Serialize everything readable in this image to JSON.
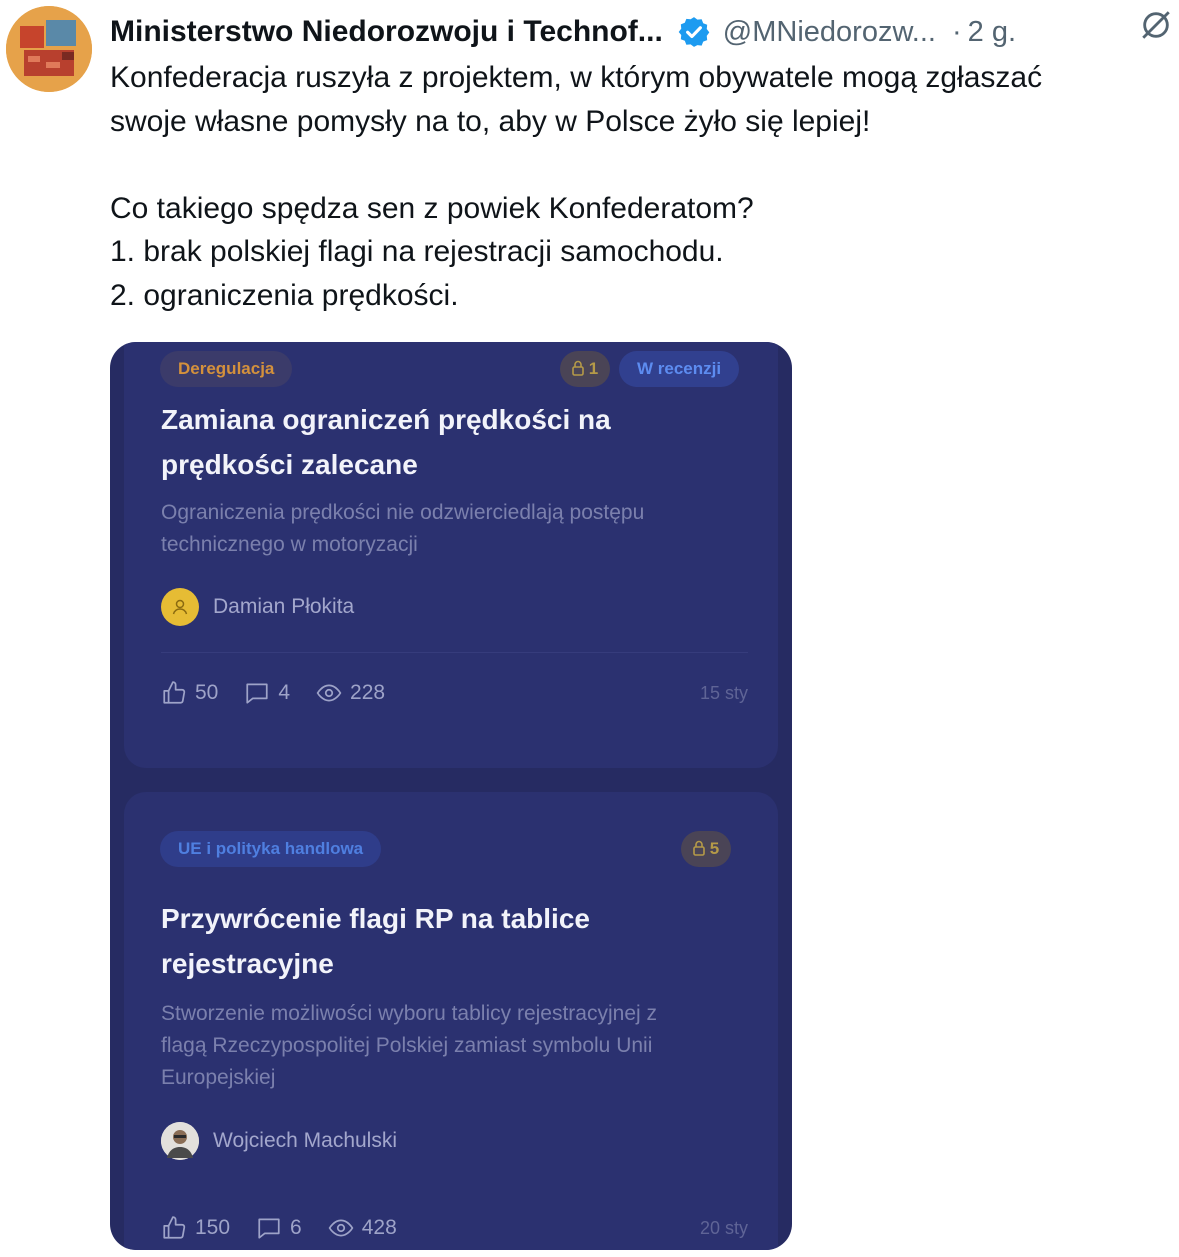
{
  "tweet": {
    "author_name": "Ministerstwo Niedorozwoju i Technof...",
    "handle": "@MNiedorozw...",
    "separator": "·",
    "time": "2 g.",
    "lines": [
      "Konfederacja ruszyła z projektem, w którym obywatele mogą zgłaszać",
      "swoje własne pomysły na to, aby w Polsce żyło się lepiej!",
      "",
      "Co takiego spędza sen z powiek Konfederatom?",
      "1. brak polskiej flagi na rejestracji samochodu.",
      "2. ograniczenia prędkości."
    ],
    "verified_color": "#1d9bf0"
  },
  "cards": [
    {
      "category": "Deregulacja",
      "lock_count": "1",
      "status": "W recenzji",
      "title_lines": [
        "Zamiana ograniczeń prędkości na",
        "prędkości zalecane"
      ],
      "desc_lines": [
        "Ograniczenia prędkości nie odzwierciedlają postępu",
        "technicznego w motoryzacji"
      ],
      "author": "Damian Płokita",
      "likes": "50",
      "comments": "4",
      "views": "228",
      "date": "15 sty"
    },
    {
      "category": "UE i polityka handlowa",
      "lock_count": "5",
      "title_lines": [
        "Przywrócenie flagi RP na tablice",
        "rejestracyjne"
      ],
      "desc_lines": [
        "Stworzenie możliwości wyboru tablicy rejestracyjnej z",
        "flagą Rzeczypospolitej Polskiej zamiast symbolu Unii",
        "Europejskiej"
      ],
      "author": "Wojciech Machulski",
      "likes": "150",
      "comments": "6",
      "views": "428",
      "date": "20 sty"
    }
  ]
}
